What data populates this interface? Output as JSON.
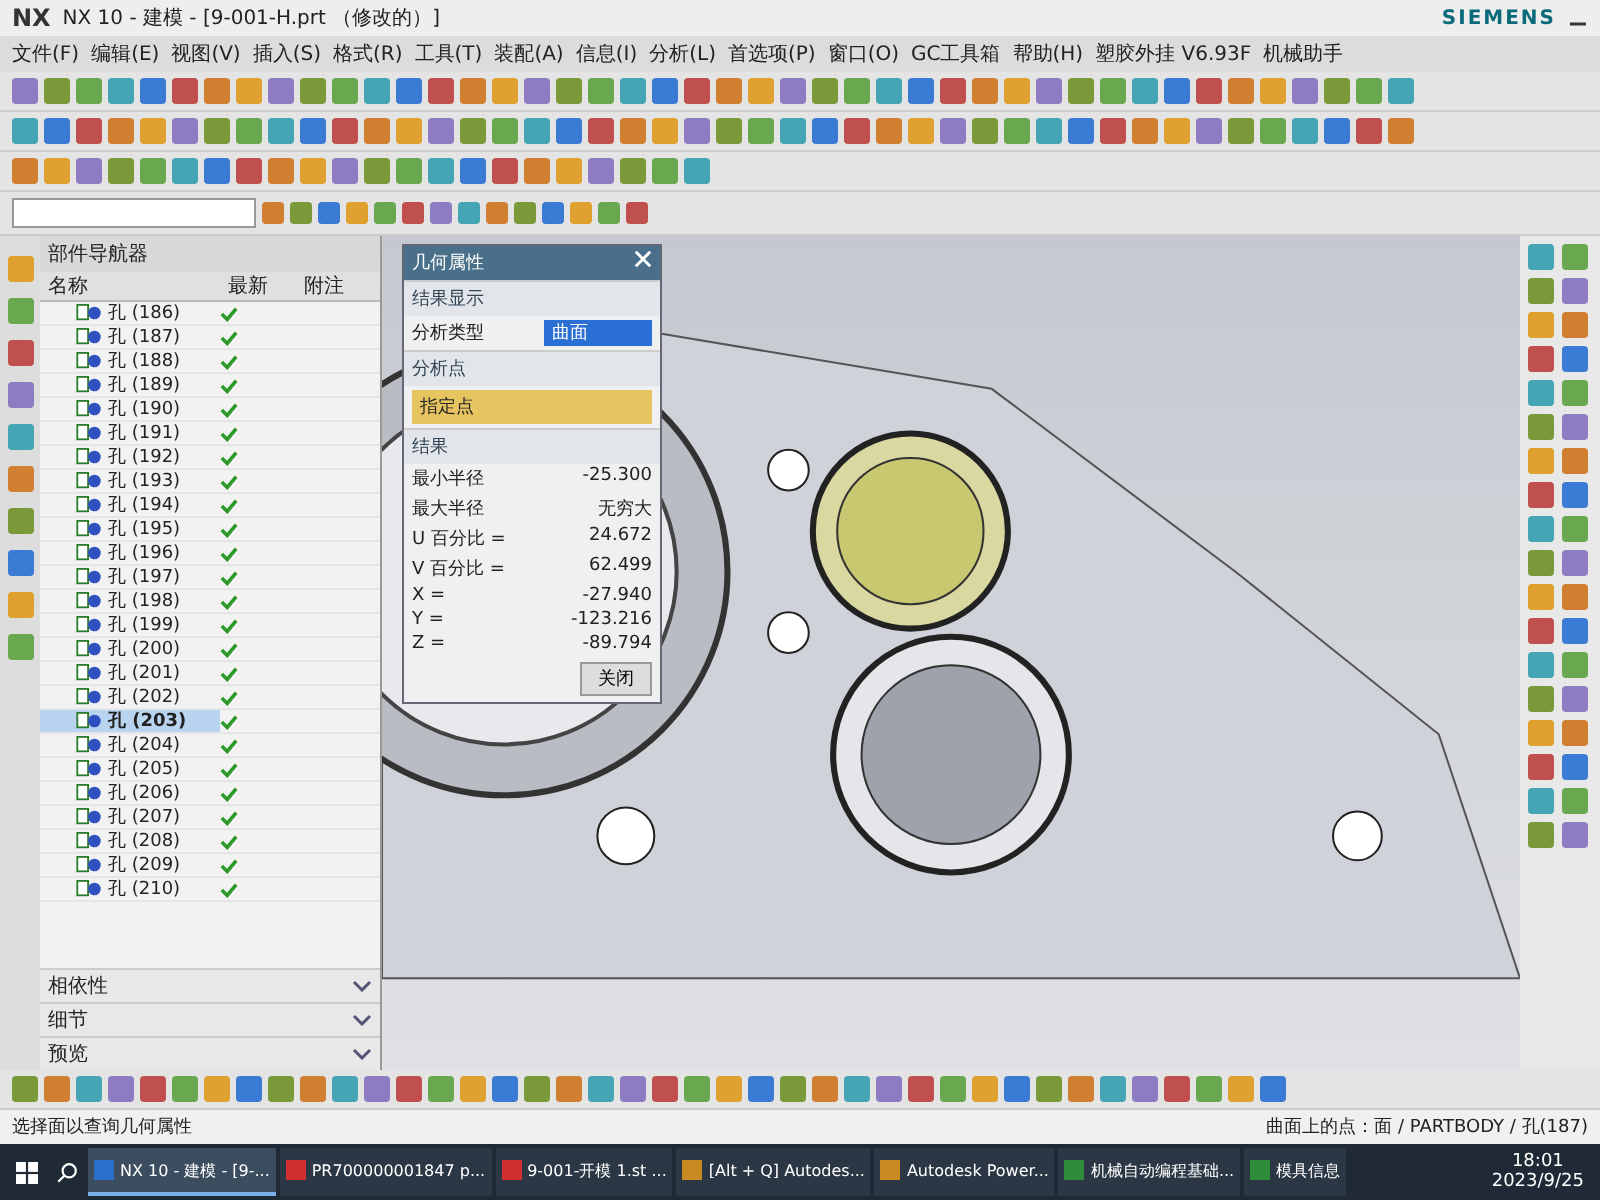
{
  "window": {
    "app": "NX",
    "title": "NX 10 - 建模 - [9-001-H.prt （修改的）]",
    "brand": "SIEMENS"
  },
  "menu": [
    "文件(F)",
    "编辑(E)",
    "视图(V)",
    "插入(S)",
    "格式(R)",
    "工具(T)",
    "装配(A)",
    "信息(I)",
    "分析(L)",
    "首选项(P)",
    "窗口(O)",
    "GC工具箱",
    "帮助(H)",
    "塑胶外挂 V6.93F",
    "机械助手"
  ],
  "navigator": {
    "title": "部件导航器",
    "columns": [
      "名称",
      "最新",
      "附注"
    ],
    "rows": [
      {
        "name": "孔 (186)",
        "latest": true,
        "selected": false
      },
      {
        "name": "孔 (187)",
        "latest": true,
        "selected": false
      },
      {
        "name": "孔 (188)",
        "latest": true,
        "selected": false
      },
      {
        "name": "孔 (189)",
        "latest": true,
        "selected": false
      },
      {
        "name": "孔 (190)",
        "latest": true,
        "selected": false
      },
      {
        "name": "孔 (191)",
        "latest": true,
        "selected": false
      },
      {
        "name": "孔 (192)",
        "latest": true,
        "selected": false
      },
      {
        "name": "孔 (193)",
        "latest": true,
        "selected": false
      },
      {
        "name": "孔 (194)",
        "latest": true,
        "selected": false
      },
      {
        "name": "孔 (195)",
        "latest": true,
        "selected": false
      },
      {
        "name": "孔 (196)",
        "latest": true,
        "selected": false
      },
      {
        "name": "孔 (197)",
        "latest": true,
        "selected": false
      },
      {
        "name": "孔 (198)",
        "latest": true,
        "selected": false
      },
      {
        "name": "孔 (199)",
        "latest": true,
        "selected": false
      },
      {
        "name": "孔 (200)",
        "latest": true,
        "selected": false
      },
      {
        "name": "孔 (201)",
        "latest": true,
        "selected": false
      },
      {
        "name": "孔 (202)",
        "latest": true,
        "selected": false
      },
      {
        "name": "孔 (203)",
        "latest": true,
        "selected": true
      },
      {
        "name": "孔 (204)",
        "latest": true,
        "selected": false
      },
      {
        "name": "孔 (205)",
        "latest": true,
        "selected": false
      },
      {
        "name": "孔 (206)",
        "latest": true,
        "selected": false
      },
      {
        "name": "孔 (207)",
        "latest": true,
        "selected": false
      },
      {
        "name": "孔 (208)",
        "latest": true,
        "selected": false
      },
      {
        "name": "孔 (209)",
        "latest": true,
        "selected": false
      },
      {
        "name": "孔 (210)",
        "latest": true,
        "selected": false
      }
    ],
    "sections": [
      "相依性",
      "细节",
      "预览"
    ]
  },
  "dialog": {
    "title": "几何属性",
    "display_group": "结果显示",
    "type_label": "分析类型",
    "type_value": "曲面",
    "point_group": "分析点",
    "point_value": "指定点",
    "result_group": "结果",
    "results": [
      {
        "label": "最小半径",
        "value": "-25.300"
      },
      {
        "label": "最大半径",
        "value": "无穷大"
      },
      {
        "label": "U 百分比 =",
        "value": "24.672"
      },
      {
        "label": "V 百分比 =",
        "value": "62.499"
      },
      {
        "label": "X =",
        "value": "-27.940"
      },
      {
        "label": "Y =",
        "value": "-123.216"
      },
      {
        "label": "Z =",
        "value": "-89.794"
      }
    ],
    "close": "关闭"
  },
  "status": {
    "prompt": "选择面以查询几何属性",
    "info": "曲面上的点：面 / PARTBODY / 孔(187)"
  },
  "taskbar": {
    "items": [
      {
        "label": "NX 10 - 建模 - [9-...",
        "kind": "nx",
        "selected": true
      },
      {
        "label": "PR700000001847 p...",
        "kind": "wps",
        "selected": false
      },
      {
        "label": "9-001-开模 1.st ...",
        "kind": "wps",
        "selected": false
      },
      {
        "label": "[Alt + Q] Autodes...",
        "kind": "power",
        "selected": false
      },
      {
        "label": "Autodesk Power...",
        "kind": "power",
        "selected": false
      },
      {
        "label": "机械自动编程基础...",
        "kind": "excel",
        "selected": false
      },
      {
        "label": "模具信息",
        "kind": "excel",
        "selected": false
      }
    ],
    "time": "18:01",
    "date": "2023/9/25"
  }
}
